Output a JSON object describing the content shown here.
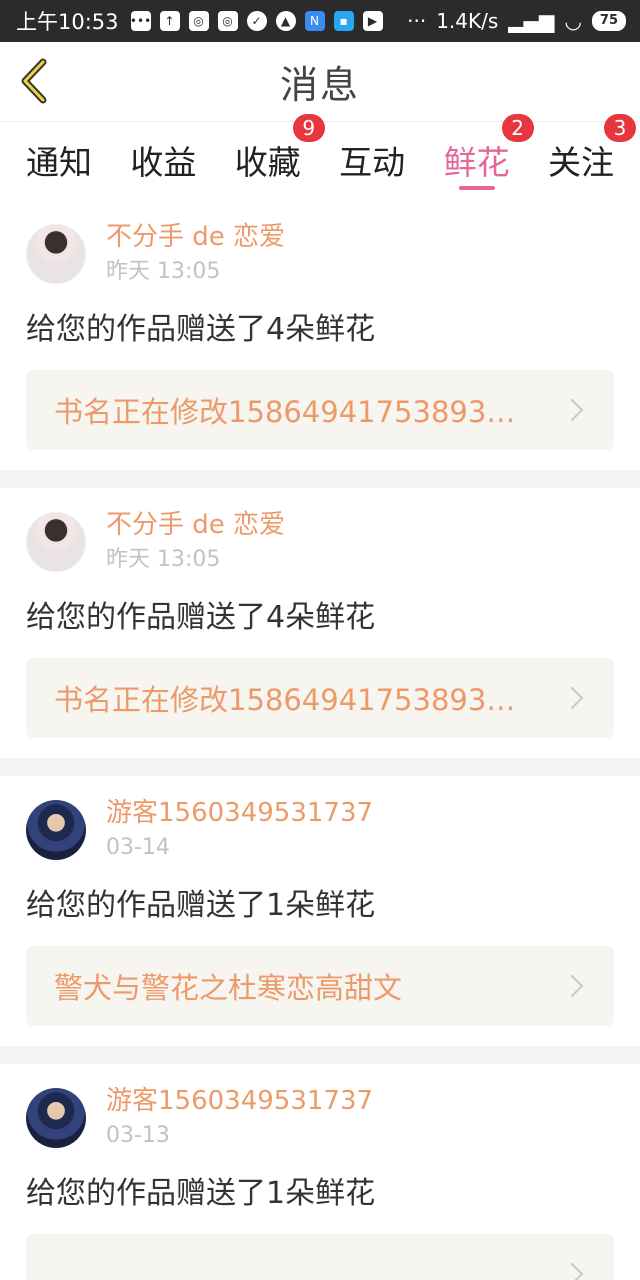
{
  "statusbar": {
    "time": "上午10:53",
    "net_speed": "1.4K/s",
    "battery": "75"
  },
  "header": {
    "title": "消息"
  },
  "tabs": [
    {
      "label": "通知",
      "badge": ""
    },
    {
      "label": "收益",
      "badge": ""
    },
    {
      "label": "收藏",
      "badge": "9"
    },
    {
      "label": "互动",
      "badge": ""
    },
    {
      "label": "鲜花",
      "badge": "2",
      "active": true
    },
    {
      "label": "关注",
      "badge": "3"
    }
  ],
  "messages": [
    {
      "user": "不分手 de 恋爱",
      "time": "昨天 13:05",
      "text": "给您的作品赠送了4朵鲜花",
      "book": "书名正在修改15864941753893…"
    },
    {
      "user": "不分手 de 恋爱",
      "time": "昨天 13:05",
      "text": "给您的作品赠送了4朵鲜花",
      "book": "书名正在修改15864941753893…"
    },
    {
      "user": "游客1560349531737",
      "time": "03-14",
      "text": "给您的作品赠送了1朵鲜花",
      "book": "警犬与警花之杜寒恋高甜文"
    },
    {
      "user": "游客1560349531737",
      "time": "03-13",
      "text": "给您的作品赠送了1朵鲜花",
      "book": ""
    }
  ],
  "colors": {
    "accent": "#e5679a",
    "username": "#ed9a6b",
    "badge": "#e8363e"
  }
}
